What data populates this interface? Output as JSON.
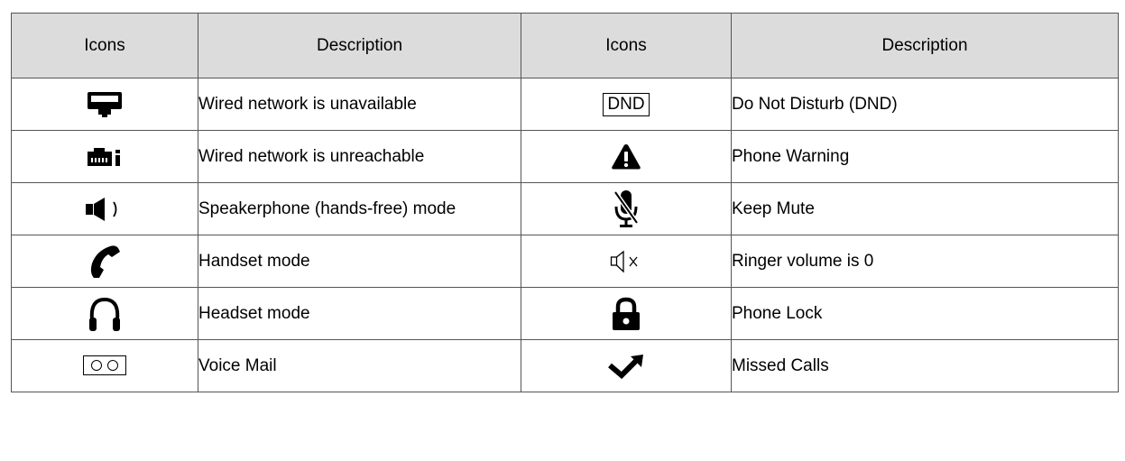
{
  "headers": {
    "icons_left": "Icons",
    "desc_left": "Description",
    "icons_right": "Icons",
    "desc_right": "Description"
  },
  "rows": [
    {
      "left_icon": "wired-network-unavailable-icon",
      "left_desc": "Wired network is unavailable",
      "right_icon": "dnd-icon",
      "right_icon_text": "DND",
      "right_desc": "Do Not Disturb (DND)"
    },
    {
      "left_icon": "wired-network-unreachable-icon",
      "left_desc": "Wired network is unreachable",
      "right_icon": "warning-icon",
      "right_desc": "Phone Warning"
    },
    {
      "left_icon": "speakerphone-icon",
      "left_desc": "Speakerphone (hands-free) mode",
      "right_icon": "microphone-muted-icon",
      "right_desc": "Keep Mute"
    },
    {
      "left_icon": "handset-icon",
      "left_desc": "Handset mode",
      "right_icon": "ringer-off-icon",
      "right_desc": "Ringer volume is 0"
    },
    {
      "left_icon": "headset-icon",
      "left_desc": "Headset mode",
      "right_icon": "lock-icon",
      "right_desc": "Phone Lock"
    },
    {
      "left_icon": "voicemail-icon",
      "left_desc": "Voice Mail",
      "right_icon": "missed-call-icon",
      "right_desc": "Missed Calls"
    }
  ]
}
